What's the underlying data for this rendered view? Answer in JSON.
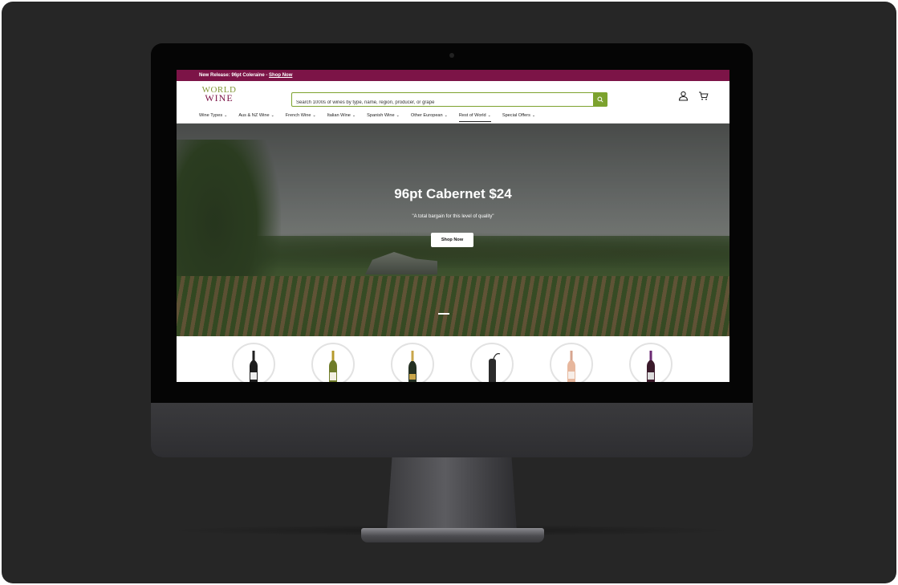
{
  "announcement": {
    "text": "New Release: 96pt Coleraine - ",
    "link": "Shop Now"
  },
  "logo": {
    "line1": "WORLD",
    "line2": "WINE"
  },
  "search": {
    "placeholder": "Search 1000s of wines by type, name, region, producer, or grape",
    "button_icon": "search-icon"
  },
  "header_icons": [
    "account-icon",
    "cart-icon"
  ],
  "nav": {
    "items": [
      {
        "label": "Wine Types"
      },
      {
        "label": "Aus & NZ Wine"
      },
      {
        "label": "French Wine"
      },
      {
        "label": "Italian Wine"
      },
      {
        "label": "Spanish Wine"
      },
      {
        "label": "Other European"
      },
      {
        "label": "Rest of World"
      },
      {
        "label": "Special Offers"
      }
    ],
    "active": "Rest of World"
  },
  "hero": {
    "title": "96pt Cabernet $24",
    "subtitle": "\"A total bargain for this level of quality\"",
    "button": "Shop Now"
  },
  "categories": [
    {
      "icon": "red-wine-bottle-icon"
    },
    {
      "icon": "white-wine-bottle-icon"
    },
    {
      "icon": "sparkling-wine-bottle-icon"
    },
    {
      "icon": "wine-accessory-icon"
    },
    {
      "icon": "rose-wine-bottle-icon"
    },
    {
      "icon": "fortified-wine-bottle-icon"
    }
  ],
  "colors": {
    "brand_purple": "#7c1447",
    "brand_green": "#7ca22e",
    "frame_bg": "#262626"
  }
}
